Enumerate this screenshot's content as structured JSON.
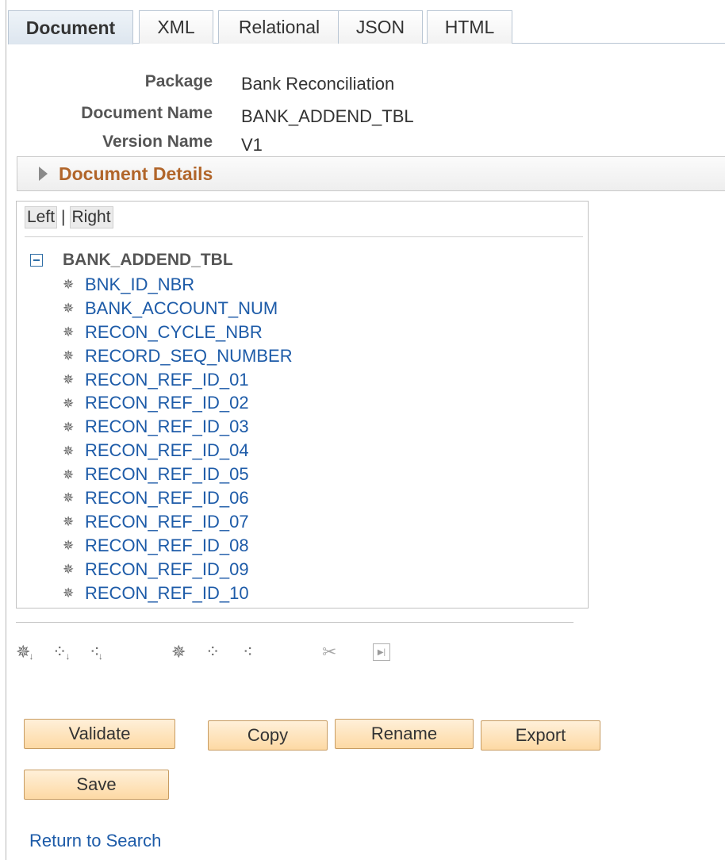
{
  "tabs": [
    {
      "label": "Document",
      "active": true
    },
    {
      "label": "XML",
      "active": false
    },
    {
      "label": "Relational",
      "active": false
    },
    {
      "label": "JSON",
      "active": false
    },
    {
      "label": "HTML",
      "active": false
    }
  ],
  "fields": {
    "package": {
      "label": "Package",
      "value": "Bank Reconciliation"
    },
    "document_name": {
      "label": "Document Name",
      "value": "BANK_ADDEND_TBL"
    },
    "version_name": {
      "label": "Version Name",
      "value": "V1"
    }
  },
  "details": {
    "title": "Document Details",
    "expanded": false
  },
  "tree": {
    "left_label": "Left",
    "separator": "|",
    "right_label": "Right",
    "root": "BANK_ADDEND_TBL",
    "items": [
      "BNK_ID_NBR",
      "BANK_ACCOUNT_NUM",
      "RECON_CYCLE_NBR",
      "RECORD_SEQ_NUMBER",
      "RECON_REF_ID_01",
      "RECON_REF_ID_02",
      "RECON_REF_ID_03",
      "RECON_REF_ID_04",
      "RECON_REF_ID_05",
      "RECON_REF_ID_06",
      "RECON_REF_ID_07",
      "RECON_REF_ID_08",
      "RECON_REF_ID_09",
      "RECON_REF_ID_10"
    ]
  },
  "toolbar": {
    "icons": [
      "add-primitive-child-icon",
      "add-compound-child-icon",
      "add-collection-child-icon",
      "add-primitive-icon",
      "add-compound-icon",
      "add-collection-icon",
      "cut-icon",
      "move-icon"
    ]
  },
  "buttons": {
    "validate": "Validate",
    "copy": "Copy",
    "rename": "Rename",
    "export": "Export",
    "save": "Save"
  },
  "links": {
    "return_to_search": "Return to Search"
  },
  "colors": {
    "link": "#1d5ba8",
    "section_title": "#b1652a",
    "button_fill": "#fdd9a4"
  }
}
